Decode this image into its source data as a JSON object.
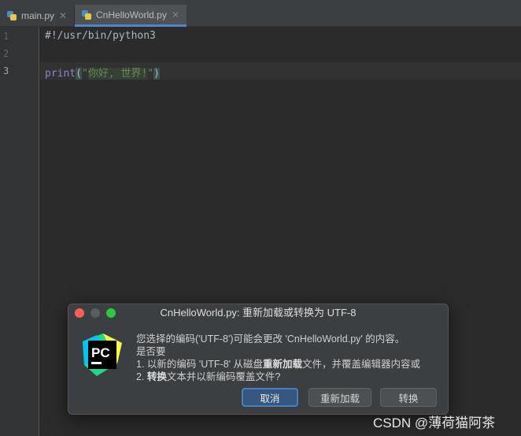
{
  "tabs": [
    {
      "label": "main.py"
    },
    {
      "label": "CnHelloWorld.py",
      "active": true
    }
  ],
  "editor": {
    "line_numbers": [
      "1",
      "2",
      "3"
    ],
    "current_line": "3",
    "line1": "#!/usr/bin/python3",
    "line3": {
      "keyword": "print",
      "open_paren": "(",
      "quote_open": "\"",
      "string_text": "你好, 世界!",
      "quote_close": "\"",
      "close_paren": ")"
    }
  },
  "dialog": {
    "title": "CnHelloWorld.py: 重新加载或转换为 UTF-8",
    "line1": "您选择的编码('UTF-8')可能会更改 'CnHelloWorld.py' 的内容。",
    "line2": "是否要",
    "line3_a": "1. 以新的编码 'UTF-8' 从磁盘",
    "line3_bold": "重新加载",
    "line3_b": "文件，并覆盖编辑器内容或",
    "line4_a": "2. ",
    "line4_bold": "转换",
    "line4_b": "文本并以新编码覆盖文件?",
    "buttons": {
      "cancel": "取消",
      "reload": "重新加载",
      "convert": "转换"
    },
    "logo_text": "PC"
  },
  "watermark": "CSDN @薄荷猫阿茶",
  "colors": {
    "editor_bg": "#2b2b2b",
    "accent": "#4a88c7",
    "string": "#6a8759",
    "keyword": "#8888c6"
  }
}
